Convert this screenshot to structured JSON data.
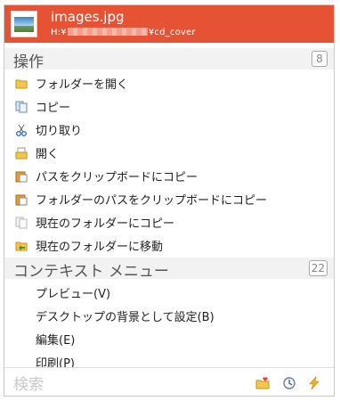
{
  "header": {
    "title": "images.jpg",
    "path_prefix": "H:¥",
    "path_suffix": "¥cd_cover"
  },
  "sections": {
    "ops": {
      "title": "操作",
      "count": "8"
    },
    "context": {
      "title": "コンテキスト メニュー",
      "count": "22"
    }
  },
  "ops_items": [
    {
      "label": "フォルダーを開く",
      "icon": "folder-open-icon"
    },
    {
      "label": "コピー",
      "icon": "copy-icon"
    },
    {
      "label": "切り取り",
      "icon": "scissors-icon"
    },
    {
      "label": "開く",
      "icon": "open-icon"
    },
    {
      "label": "パスをクリップボードにコピー",
      "icon": "clipboard-icon"
    },
    {
      "label": "フォルダーのパスをクリップボードにコピー",
      "icon": "clipboard-folder-icon"
    },
    {
      "label": "現在のフォルダーにコピー",
      "icon": "copy-to-folder-icon"
    },
    {
      "label": "現在のフォルダーに移動",
      "icon": "move-to-folder-icon"
    }
  ],
  "context_items": [
    {
      "label": "プレビュー(V)"
    },
    {
      "label": "デスクトップの背景として設定(B)"
    },
    {
      "label": "編集(E)"
    },
    {
      "label": "印刷(P)"
    }
  ],
  "search": {
    "placeholder": "検索"
  },
  "colors": {
    "header": "#e55234",
    "section_bg": "#f2f2f2"
  }
}
